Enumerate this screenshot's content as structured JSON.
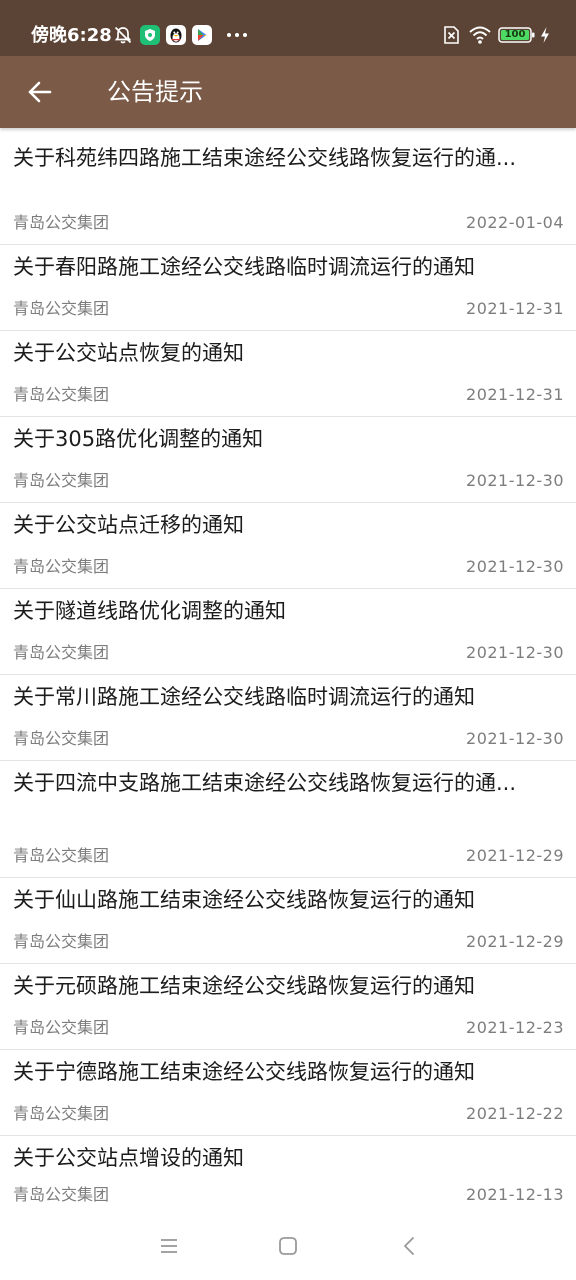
{
  "status_bar": {
    "time": "傍晚6:28",
    "battery": "100",
    "icons": [
      "alarm-off-icon",
      "shield-app-icon",
      "qq-penguin-icon",
      "play-store-icon",
      "more-dots-icon",
      "no-sim-icon",
      "wifi-icon",
      "battery-icon",
      "charging-bolt-icon"
    ]
  },
  "app_bar": {
    "title": "公告提示",
    "back_icon": "arrow-left-icon"
  },
  "notices": [
    {
      "title": "关于科苑纬四路施工结束途经公交线路恢复运行的通...",
      "source": "青岛公交集团",
      "date": "2022-01-04"
    },
    {
      "title": "关于春阳路施工途经公交线路临时调流运行的通知",
      "source": "青岛公交集团",
      "date": "2021-12-31"
    },
    {
      "title": "关于公交站点恢复的通知",
      "source": "青岛公交集团",
      "date": "2021-12-31"
    },
    {
      "title": "关于305路优化调整的通知",
      "source": "青岛公交集团",
      "date": "2021-12-30"
    },
    {
      "title": "关于公交站点迁移的通知",
      "source": "青岛公交集团",
      "date": "2021-12-30"
    },
    {
      "title": "关于隧道线路优化调整的通知",
      "source": "青岛公交集团",
      "date": "2021-12-30"
    },
    {
      "title": "关于常川路施工途经公交线路临时调流运行的通知",
      "source": "青岛公交集团",
      "date": "2021-12-30"
    },
    {
      "title": "关于四流中支路施工结束途经公交线路恢复运行的通...",
      "source": "青岛公交集团",
      "date": "2021-12-29"
    },
    {
      "title": "关于仙山路施工结束途经公交线路恢复运行的通知",
      "source": "青岛公交集团",
      "date": "2021-12-29"
    },
    {
      "title": "关于元硕路施工结束途经公交线路恢复运行的通知",
      "source": "青岛公交集团",
      "date": "2021-12-23"
    },
    {
      "title": "关于宁德路施工结束途经公交线路恢复运行的通知",
      "source": "青岛公交集团",
      "date": "2021-12-22"
    },
    {
      "title": "关于公交站点增设的通知",
      "source": "青岛公交集团",
      "date": "2021-12-13"
    }
  ],
  "nav_bar": {
    "icons": [
      "menu-icon",
      "home-square-icon",
      "back-chevron-icon"
    ]
  },
  "colors": {
    "status_bar_bg": "#5b4335",
    "app_bar_bg": "#7b5a48",
    "title_text": "#1c1c1c",
    "meta_text": "#7d7d7d",
    "divider": "#e4e4e4"
  }
}
